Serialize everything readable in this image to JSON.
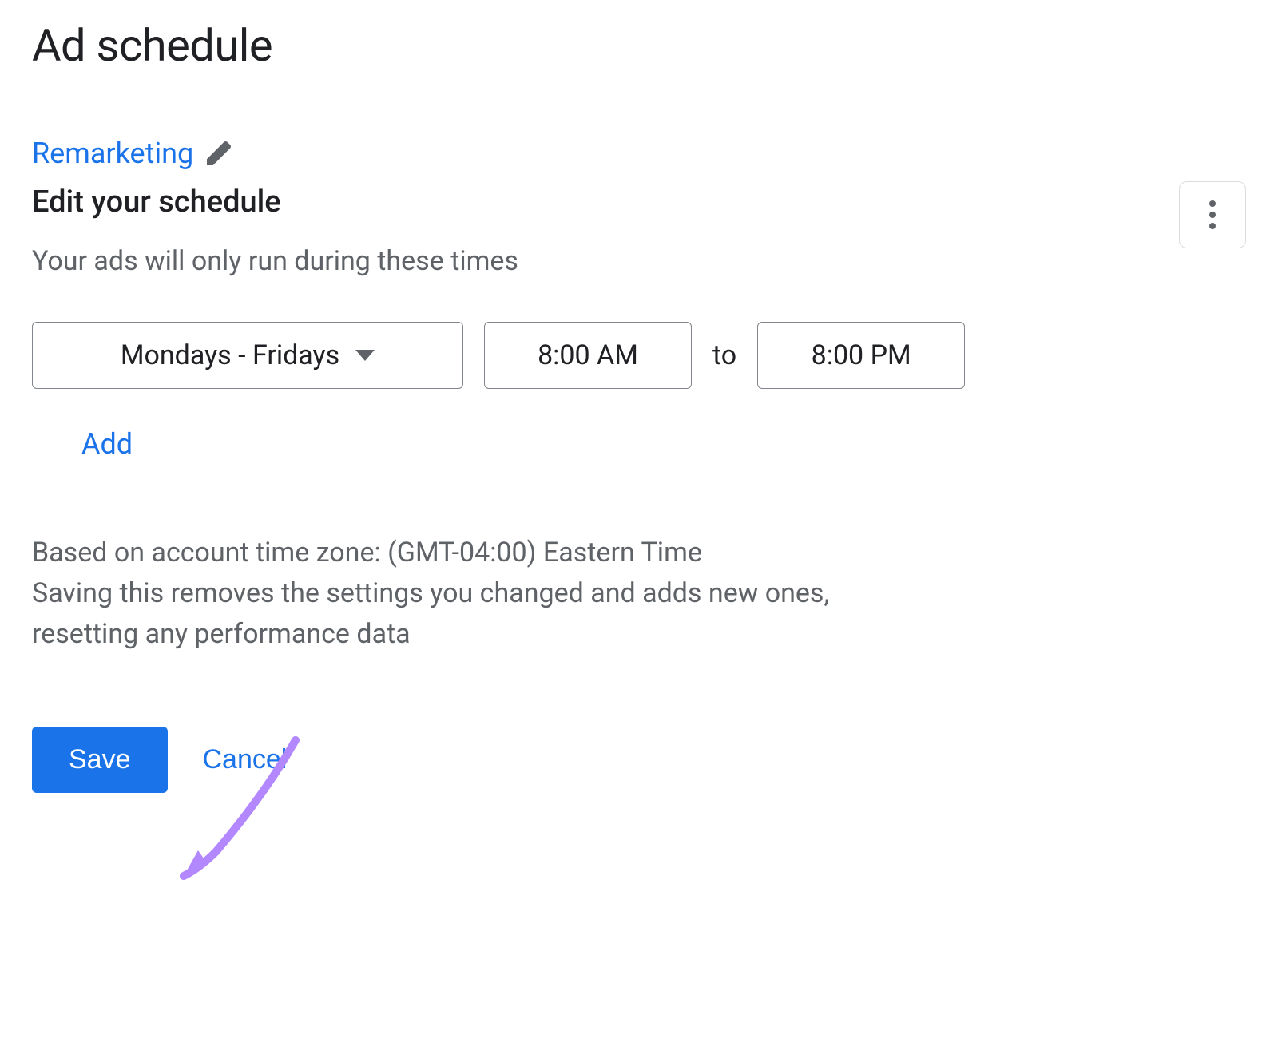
{
  "header": {
    "title": "Ad schedule"
  },
  "campaign": {
    "name": "Remarketing"
  },
  "edit": {
    "subheading": "Edit your schedule",
    "description": "Your ads will only run during these times"
  },
  "schedule": {
    "days": "Mondays - Fridays",
    "start_time": "8:00 AM",
    "to_label": "to",
    "end_time": "8:00 PM"
  },
  "actions": {
    "add_label": "Add",
    "save_label": "Save",
    "cancel_label": "Cancel"
  },
  "info": {
    "timezone_text": "Based on account time zone: (GMT-04:00) Eastern Time",
    "warning_text": "Saving this removes the settings you changed and adds new ones, resetting any performance data"
  },
  "annotation": {
    "arrow_color": "#b388ff"
  }
}
